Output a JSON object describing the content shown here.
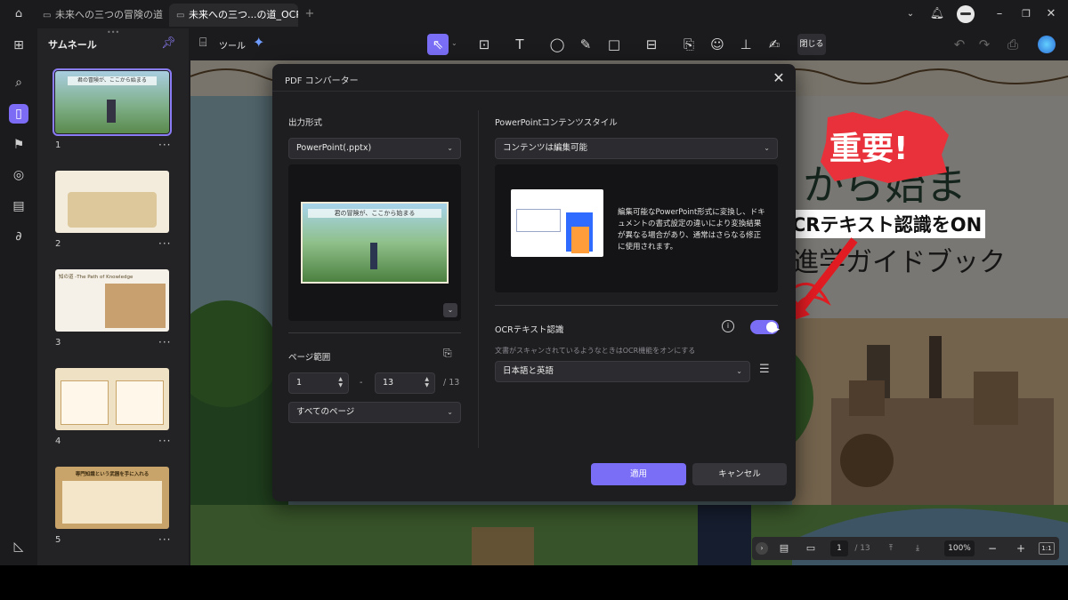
{
  "titlebar": {
    "tabs": [
      {
        "label": "未来への三つの冒険の道"
      },
      {
        "label": "未来への三つ...の道_OCR"
      }
    ]
  },
  "sidebar": {
    "title": "サムネール",
    "pages": [
      "1",
      "2",
      "3",
      "4",
      "5"
    ],
    "page1_title": "君の冒険が、ここから始まる",
    "page3_title": "知の道 -The Path of Knowledge",
    "page5_title": "専門知識という武器を手に入れる"
  },
  "toolbar": {
    "tools_label": "ツール",
    "close_label": "閉じる"
  },
  "dialog": {
    "title": "PDF コンバーター",
    "output_label": "出力形式",
    "output_value": "PowerPoint(.pptx)",
    "preview_title": "君の冒険が、ここから始まる",
    "page_range_label": "ページ範囲",
    "page_from": "1",
    "page_dash": "-",
    "page_to": "13",
    "page_total": "/ 13",
    "pages_select": "すべてのページ",
    "style_label": "PowerPointコンテンツスタイル",
    "style_value": "コンテンツは編集可能",
    "style_desc": "編集可能なPowerPoint形式に変換し、ドキュメントの書式設定の違いにより変換結果が異なる場合があり、通常はさらなる修正に使用されます。",
    "ocr_label": "OCRテキスト認識",
    "ocr_hint": "文書がスキャンされているようなときはOCR機能をオンにする",
    "ocr_enabled": true,
    "ocr_language": "日本語と英語",
    "apply_label": "適用",
    "cancel_label": "キャンセル"
  },
  "document": {
    "heading_fragment": "から始ま",
    "subtitle_fragment": "進学ガイドブック"
  },
  "annotations": {
    "stamp_text": "重要!",
    "callout_text": "OCRテキスト認識をON"
  },
  "statusbar": {
    "page_current": "1",
    "page_total": "/ 13",
    "zoom": "100%",
    "fit_label": "1:1"
  },
  "colors": {
    "accent": "#7a6ef6",
    "stamp_red": "#e8313a"
  }
}
